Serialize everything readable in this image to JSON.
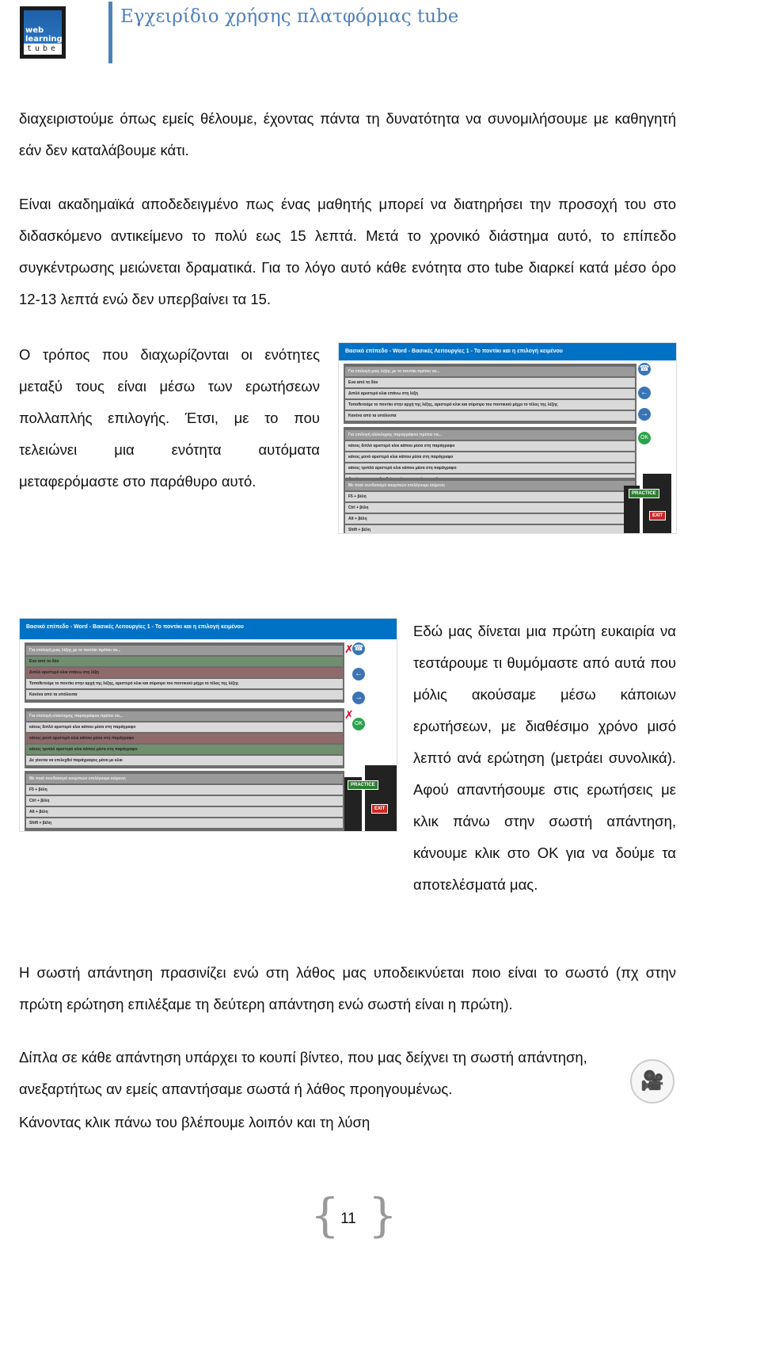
{
  "header": {
    "logo": {
      "line1": "web",
      "line2": "learning",
      "line3": "tube"
    },
    "title": "Εγχειρίδιο χρήσης πλατφόρμας tube",
    "accent_color": "#4f81bd"
  },
  "paragraphs": {
    "p1": "διαχειριστούμε όπως εμείς θέλουμε, έχοντας πάντα τη δυνατότητα να συνομιλήσουμε με καθηγητή εάν δεν καταλάβουμε κάτι.",
    "p2": "Είναι ακαδημαϊκά αποδεδειγμένο πως ένας μαθητής μπορεί να διατηρήσει την προσοχή του στο διδασκόμενο αντικείμενο το πολύ εως 15 λεπτά. Μετά το χρονικό διάστημα αυτό, το επίπεδο συγκέντρωσης μειώνεται δραματικά. Για το λόγο αυτό κάθε ενότητα στο tube διαρκεί κατά μέσο όρο 12-13 λεπτά ενώ δεν υπερβαίνει τα 15.",
    "p3": "Ο τρόπος που διαχωρίζονται οι ενότητες μεταξύ τους είναι μέσω των ερωτήσεων πολλαπλής επιλογής. Έτσι, με το που τελειώνει μια ενότητα αυτόματα μεταφερόμαστε στο παράθυρο αυτό.",
    "p4": "Εδώ μας δίνεται μια πρώτη ευκαιρία να τεστάρουμε τι θυμόμαστε από αυτά που μόλις ακούσαμε μέσω κάποιων ερωτήσεων, με διαθέσιμο χρόνο μισό λεπτό ανά ερώτηση (μετράει συνολικά). Αφού απαντήσουμε στις ερωτήσεις με κλικ πάνω στην σωστή απάντηση, κάνουμε κλικ στο ΟΚ για να δούμε τα αποτελέσματά μας.",
    "p5": "Η σωστή απάντηση πρασινίζει ενώ στη λάθος μας υποδεικνύεται ποιο είναι το σωστό (πχ στην πρώτη ερώτηση επιλέξαμε τη δεύτερη απάντηση ενώ σωστή είναι η πρώτη).",
    "p6a": "Δίπλα σε κάθε απάντηση υπάρχει το κουπί βίντεο, που μας δείχνει τη σωστή απάντηση, ανεξαρτήτως αν εμείς απαντήσαμε σωστά ή λάθος προηγουμένως.",
    "p6b": "Κάνοντας κλικ πάνω του βλέπουμε λοιπόν και τη λύση"
  },
  "quiz_screenshot": {
    "title": "Βασικό επίπεδο - Word - Βασικές Λειτουργίες 1 - Το ποντίκι και η επιλογή κειμένου",
    "ok_label": "OK",
    "practice_label": "PRACTICE",
    "exit_label": "EXIT",
    "questions": [
      {
        "q": "Για επιλογή μιας λέξης με το ποντίκι πρέπει να...",
        "answers": [
          "Ενα από τα δύο",
          "Διπλό αριστερό κλικ επάνω στη λέξη",
          "Τοποθετούμε το ποντίκι στην αρχή της λέξης, αριστερό κλικ και σύρσιμο του ποντικιού μέχρι το τέλος της λέξης",
          "Κανένα από τα υπόλοιπα"
        ]
      },
      {
        "q": "Για επιλογή ολόκληρης παραγράφου πρέπει να...",
        "answers": [
          "κάνεις διπλό αριστερό κλικ κάπου μέσα στη παράγραφο",
          "κάνεις μονό αριστερό κλικ κάπου μέσα στη παράγραφο",
          "κάνεις τριπλό αριστερό κλικ κάπου μέσα στη παράγραφο",
          "Δε γίνεται να επιλεχθεί παράγραφος μόνο με κλικ"
        ]
      },
      {
        "q": "Με ποιό συνδυασμό κουμπιών επιλέγουμε κείμενο;",
        "answers": [
          "F5 + βέλη",
          "Ctrl + βέλη",
          "Alt + βέλη",
          "Shift + βέλη"
        ]
      }
    ],
    "result_colors": {
      "correct": "#6f8f6f",
      "wrong": "#8f6a6a"
    }
  },
  "footer": {
    "page_number": "11"
  }
}
